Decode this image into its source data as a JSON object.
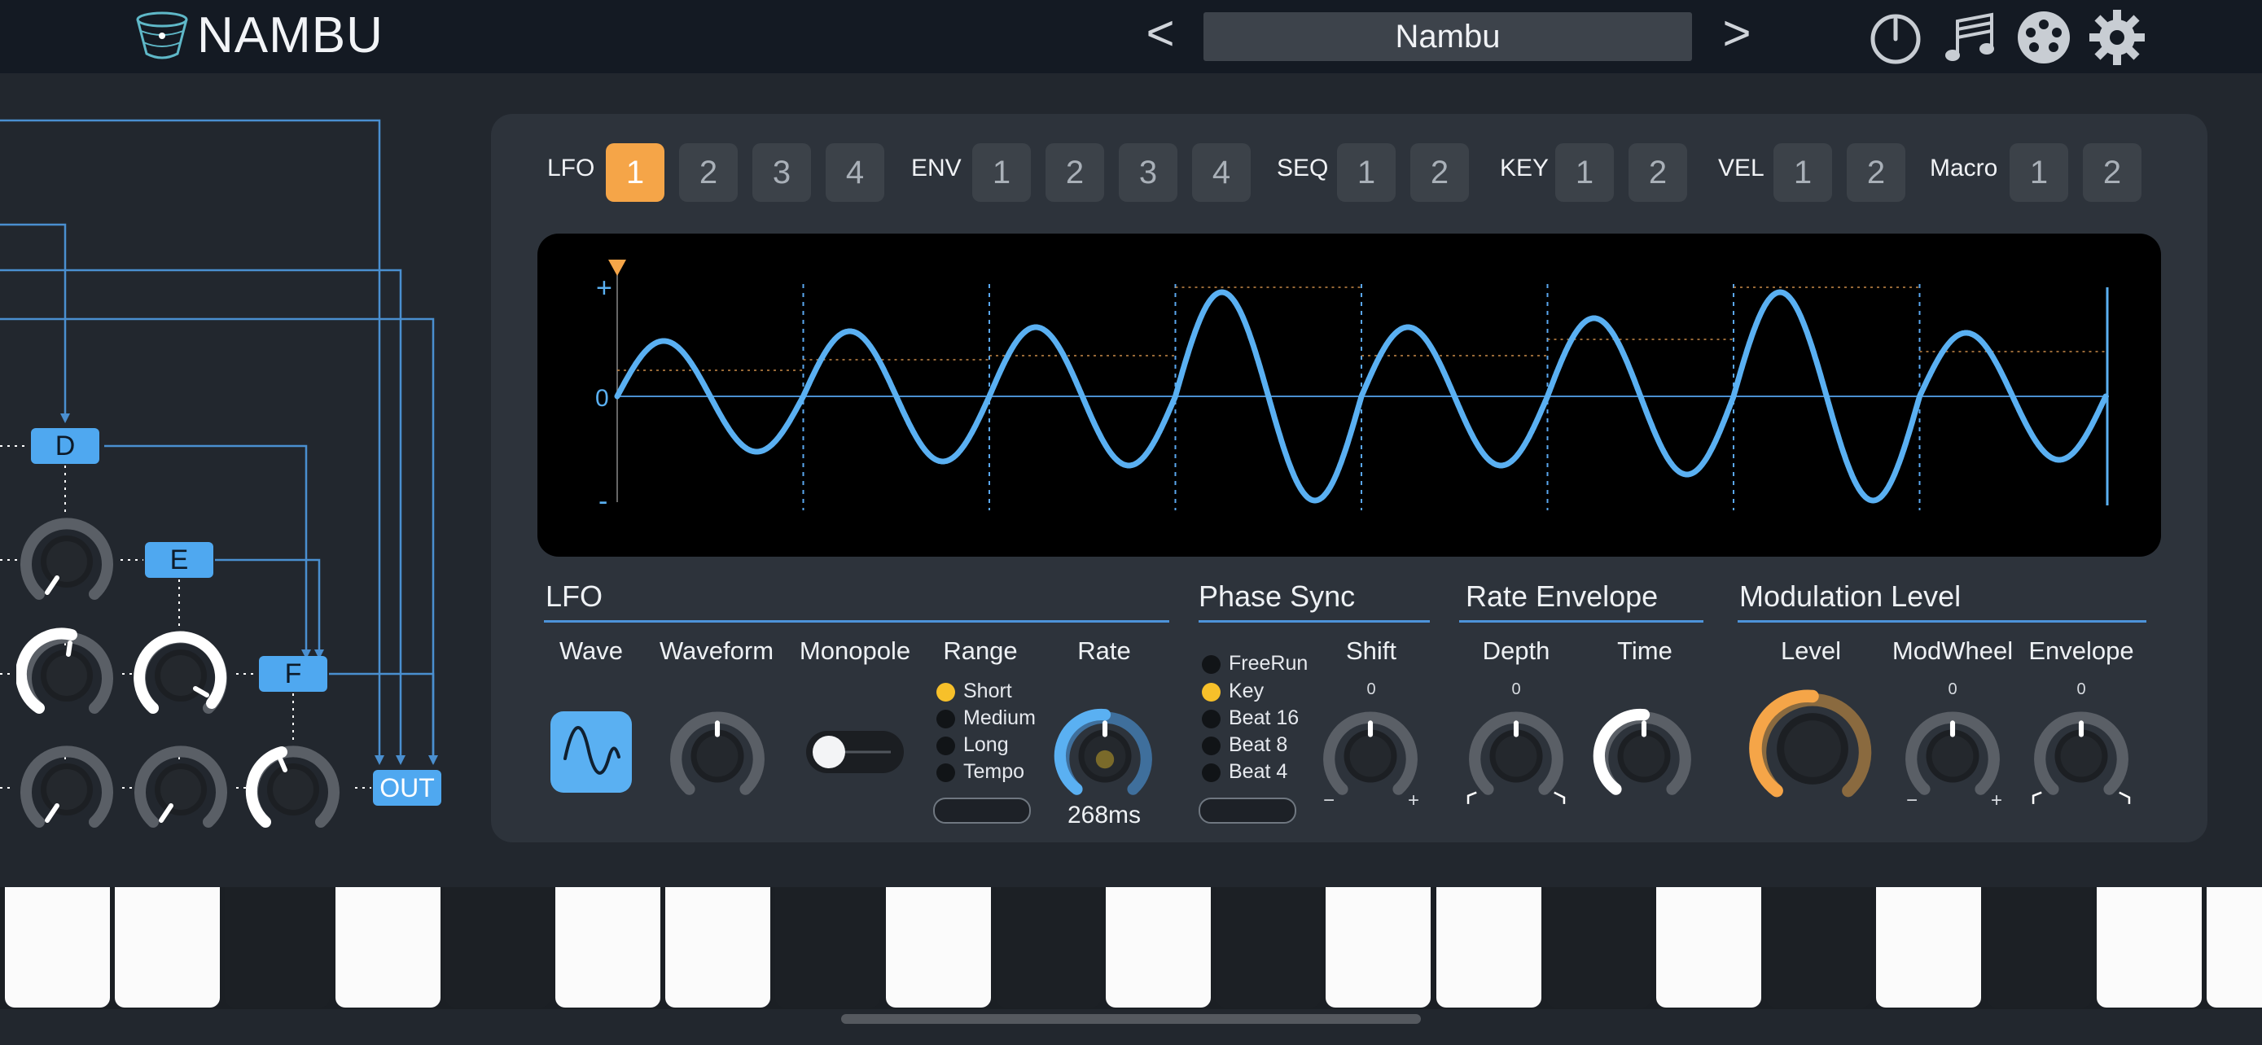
{
  "header": {
    "app_name": "NAMBU",
    "prev_label": "<",
    "next_label": ">",
    "preset_name": "Nambu",
    "icons": [
      "power-icon",
      "music-notes-icon",
      "palette-icon",
      "gear-icon"
    ]
  },
  "routing": {
    "nodes": [
      "D",
      "E",
      "F",
      "OUT"
    ]
  },
  "mod_sources": {
    "groups": [
      {
        "label": "LFO",
        "buttons": [
          "1",
          "2",
          "3",
          "4"
        ]
      },
      {
        "label": "ENV",
        "buttons": [
          "1",
          "2",
          "3",
          "4"
        ]
      },
      {
        "label": "SEQ",
        "buttons": [
          "1",
          "2"
        ]
      },
      {
        "label": "KEY",
        "buttons": [
          "1",
          "2"
        ]
      },
      {
        "label": "VEL",
        "buttons": [
          "1",
          "2"
        ]
      },
      {
        "label": "Macro",
        "buttons": [
          "1",
          "2"
        ]
      }
    ],
    "selected": "LFO 1"
  },
  "scope": {
    "plus_label": "+",
    "zero_label": "0",
    "minus_label": "-"
  },
  "lfo": {
    "title": "LFO",
    "wave_label": "Wave",
    "waveform_label": "Waveform",
    "monopole_label": "Monopole",
    "monopole_on": false,
    "range_label": "Range",
    "range_options": [
      "Short",
      "Medium",
      "Long",
      "Tempo"
    ],
    "range_selected": "Short",
    "rate_label": "Rate",
    "rate_value": "268ms"
  },
  "phase_sync": {
    "title": "Phase Sync",
    "options": [
      "FreeRun",
      "Key",
      "Beat 16",
      "Beat 8",
      "Beat 4"
    ],
    "selected": "Key",
    "shift_label": "Shift",
    "shift_value": "0",
    "shift_min": "−",
    "shift_max": "+"
  },
  "rate_envelope": {
    "title": "Rate Envelope",
    "depth_label": "Depth",
    "depth_value": "0",
    "time_label": "Time"
  },
  "modulation_level": {
    "title": "Modulation Level",
    "level_label": "Level",
    "modwheel_label": "ModWheel",
    "modwheel_value": "0",
    "modwheel_min": "−",
    "modwheel_max": "+",
    "envelope_label": "Envelope",
    "envelope_value": "0"
  },
  "colors": {
    "accent_blue": "#4fa8f0",
    "accent_orange": "#f5a548",
    "radio_on": "#f7c02a",
    "panel": "#2d333b"
  }
}
